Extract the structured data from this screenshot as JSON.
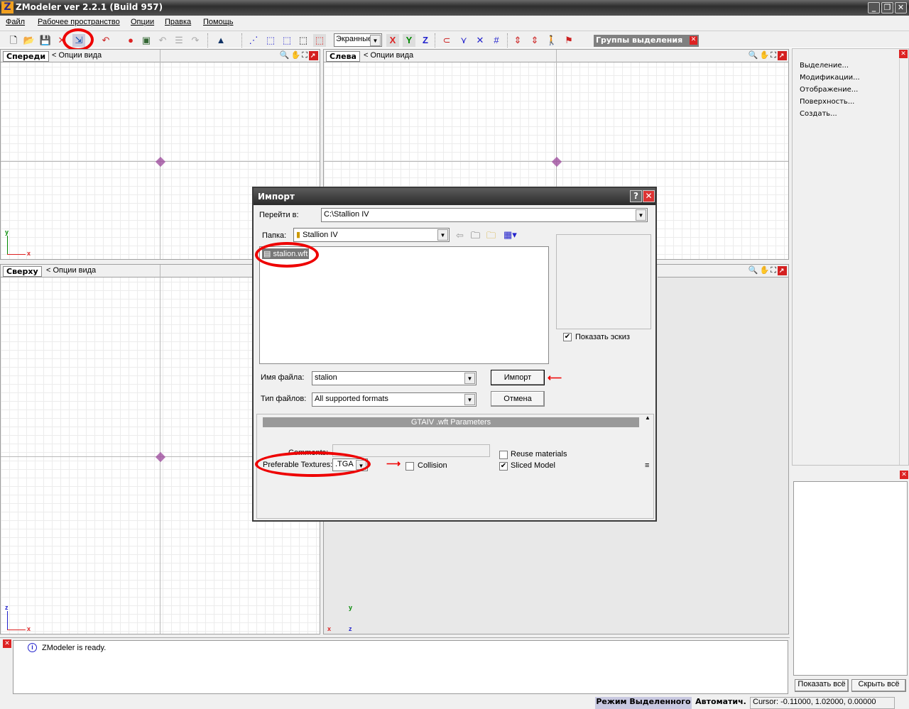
{
  "app": {
    "title": "ZModeler ver 2.2.1 (Build 957)",
    "logo": "Z"
  },
  "menu": [
    "Файл",
    "Рабочее пространство",
    "Опции",
    "Правка",
    "Помощь"
  ],
  "toolbar": {
    "coord_mode": "Экранные",
    "axes": [
      "X",
      "Y",
      "Z"
    ],
    "selection_groups": "Группы выделения"
  },
  "viewports": {
    "front": {
      "name": "Спереди",
      "options": "<  Опции вида",
      "axis_v": "y",
      "axis_h": "x"
    },
    "left": {
      "name": "Слева",
      "options": "<  Опции вида"
    },
    "top": {
      "name": "Сверху",
      "options": "<  Опции вида",
      "axis_v": "z",
      "axis_h": "x"
    },
    "persp": {
      "axis_v": "y",
      "axis_h": "x",
      "axis_d": "z"
    }
  },
  "right_panel": {
    "items": [
      "Выделение...",
      "Модификации...",
      "Отображение...",
      "Поверхность...",
      "Создать..."
    ],
    "show_all": "Показать всё",
    "hide_all": "Скрыть всё"
  },
  "log": {
    "message": "ZModeler is ready."
  },
  "status": {
    "mode": "Режим Выделенного",
    "auto": "Автоматич.",
    "cursor": "Cursor: -0.11000, 1.02000, 0.00000"
  },
  "dialog": {
    "title": "Импорт",
    "goto_label": "Перейти в:",
    "goto_value": "C:\\Stallion IV",
    "folder_label": "Папка:",
    "folder_value": "Stallion IV",
    "files": [
      "stalion.wft"
    ],
    "show_thumb": "Показать эскиз",
    "filename_label": "Имя файла:",
    "filename_value": "stalion",
    "filetype_label": "Тип файлов:",
    "filetype_value": "All supported formats",
    "import_btn": "Импорт",
    "cancel_btn": "Отмена",
    "params": {
      "header": "GTAIV .wft Parameters",
      "comments_label": "Comments:",
      "tex_label": "Preferable Textures:",
      "tex_value": ".TGA",
      "collision": "Collision",
      "reuse": "Reuse materials",
      "sliced": "Sliced Model",
      "collision_checked": false,
      "reuse_checked": false,
      "sliced_checked": true
    },
    "show_thumb_checked": true
  }
}
